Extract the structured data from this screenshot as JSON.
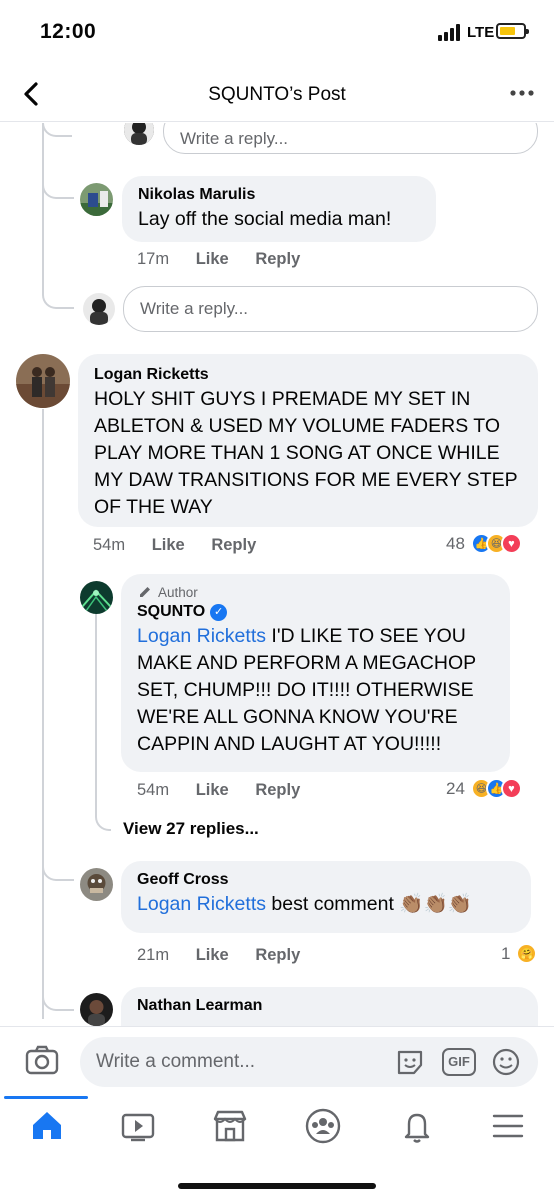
{
  "status": {
    "time": "12:00",
    "network": "LTE"
  },
  "header": {
    "title": "SQUNTO’s Post"
  },
  "comments": {
    "top_reply_placeholder": "Write a reply...",
    "nikolas": {
      "name": "Nikolas Marulis",
      "text": "Lay off the social media man!",
      "time": "17m",
      "like": "Like",
      "reply": "Reply"
    },
    "reply_placeholder_1": "Write a reply...",
    "logan": {
      "name": "Logan Ricketts",
      "text": "HOLY SHIT GUYS I PREMADE MY SET IN ABLETON & USED MY VOLUME FADERS TO PLAY MORE THAN 1 SONG AT ONCE WHILE MY DAW TRANSITIONS FOR ME EVERY STEP OF THE WAY",
      "time": "54m",
      "like": "Like",
      "reply": "Reply",
      "reactions": "48"
    },
    "squnto": {
      "badge": "Author",
      "name": "SQUNTO",
      "mention": "Logan Ricketts",
      "text": " I'D LIKE TO SEE YOU MAKE AND PERFORM A MEGACHOP SET, CHUMP!!! DO IT!!!! OTHERWISE WE'RE ALL GONNA KNOW YOU'RE CAPPIN AND LAUGHT AT YOU!!!!!",
      "time": "54m",
      "like": "Like",
      "reply": "Reply",
      "reactions": "24"
    },
    "view_replies": "View 27 replies...",
    "geoff": {
      "name": "Geoff Cross",
      "mention": "Logan Ricketts",
      "text": " best comment 👏🏽👏🏽👏🏽",
      "time": "21m",
      "like": "Like",
      "reply": "Reply",
      "reactions": "1"
    },
    "nathan": {
      "name": "Nathan Learman"
    }
  },
  "composer": {
    "placeholder": "Write a comment...",
    "gif_label": "GIF"
  },
  "colors": {
    "accent": "#1877f2",
    "mention": "#216fdb",
    "bubble": "#f0f2f5"
  }
}
